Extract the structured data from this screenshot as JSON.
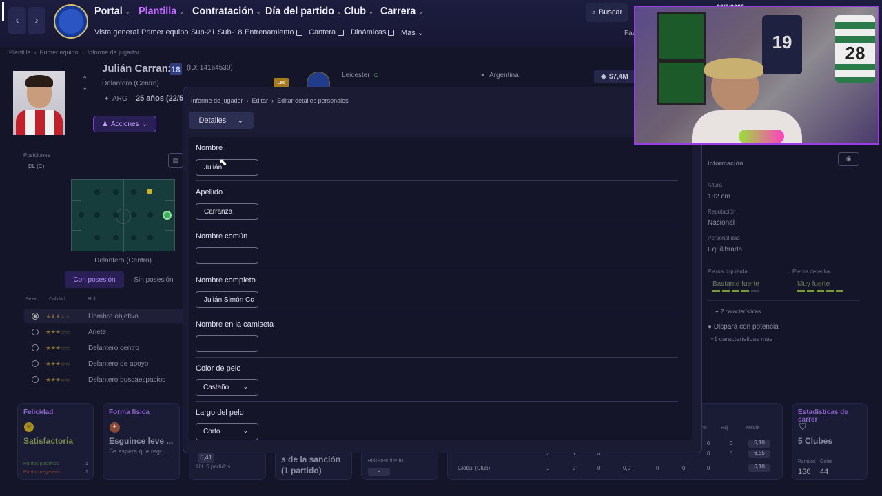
{
  "topnav": {
    "menus": [
      "Portal",
      "Plantilla",
      "Contratación",
      "Día del partido",
      "Club",
      "Carrera"
    ],
    "submenu": [
      "Vista general",
      "Primer equipo",
      "Sub-21",
      "Sub-18",
      "Entrenamiento",
      "Cantera",
      "Dinámicas",
      "Más"
    ],
    "search": "Buscar",
    "fav": "Fav",
    "date": "20/8/2025",
    "accent": "#a259ff"
  },
  "breadcrumb": [
    "Plantilla",
    "Primer equipo",
    "Informe de jugador"
  ],
  "player": {
    "name": "Julián Carranza",
    "number": "18",
    "id": "(ID: 14164530)",
    "position": "Delantero (Centro)",
    "nationality": "ARG",
    "age": "25 años (22/5",
    "actions": "Acciones",
    "club": "Leicester",
    "country": "Argentina",
    "value": "$7,4M",
    "badge": "Les"
  },
  "left": {
    "positions_label": "Posiciones",
    "position_code": "DL (C)",
    "pitch_label": "Delantero (Centro)",
    "tab_with": "Con posesión",
    "tab_without": "Sin posesión",
    "cols": [
      "Selec.",
      "Calidad",
      "Rol"
    ],
    "roles": [
      "Hombre objetivo",
      "Ariete",
      "Delantero centro",
      "Delantero de apoyo",
      "Delantero buscaespacios"
    ]
  },
  "modal": {
    "crumbs": [
      "Informe de jugador",
      "Editar",
      "Editar detalles personales"
    ],
    "section": "Detalles",
    "fields": [
      {
        "label": "Nombre",
        "value": "Julián"
      },
      {
        "label": "Apellido",
        "value": "Carranza"
      },
      {
        "label": "Nombre común",
        "value": ""
      },
      {
        "label": "Nombre completo",
        "value": "Julián Simón Cc"
      },
      {
        "label": "Nombre en la camiseta",
        "value": ""
      },
      {
        "label": "Color de pelo",
        "value": "Castaño"
      },
      {
        "label": "Largo del pelo",
        "value": "Corto"
      }
    ]
  },
  "right": {
    "info_title": "Información",
    "height_label": "Altura",
    "height": "182 cm",
    "rep_label": "Reputación",
    "rep": "Nacional",
    "pers_label": "Personalidad",
    "pers": "Equilibrada",
    "left_foot_label": "Pierna izquierda",
    "left_foot": "Bastante fuerte",
    "right_foot_label": "Pierna derecha",
    "right_foot": "Muy fuerte",
    "traits_count": "2 características",
    "trait1": "Dispara con potencia",
    "more_traits": "+1 características más"
  },
  "bottom": {
    "happy_title": "Felicidad",
    "happy_value": "Satisfactoria",
    "pos_points": "Puntos positivos",
    "pos_num": "1",
    "neg_points": "Puntos negativos",
    "neg_num": "1",
    "fitness_title": "Forma física",
    "fitness_value": "Esguince leve ...",
    "fitness_sub": "Se espera que regr...",
    "rating": "6,41",
    "rating_sub": "Últ. 5 partidos",
    "sanction": "s de la sanción",
    "sanction2": "(1 partido)",
    "training": "entrenamiento",
    "stats_cols": [
      "no",
      "Raj",
      "Media"
    ],
    "stats_rows": [
      {
        "name": "",
        "vals": [
          "0",
          "0",
          "6,10"
        ]
      },
      {
        "name": "No oficiales",
        "vals": [
          "2",
          "1",
          "0",
          "0",
          "0,0",
          "0",
          "0",
          "0",
          "6,55"
        ]
      },
      {
        "name": "Global (Club)",
        "vals": [
          "1",
          "0",
          "0",
          "0,0",
          "0",
          "0",
          "0",
          "6,10"
        ]
      }
    ],
    "career_title": "Estadísticas de carrer",
    "career_clubs": "5 Clubes",
    "played_label": "Partidos",
    "goals_label": "Goles",
    "played": "160",
    "goals": "44"
  }
}
